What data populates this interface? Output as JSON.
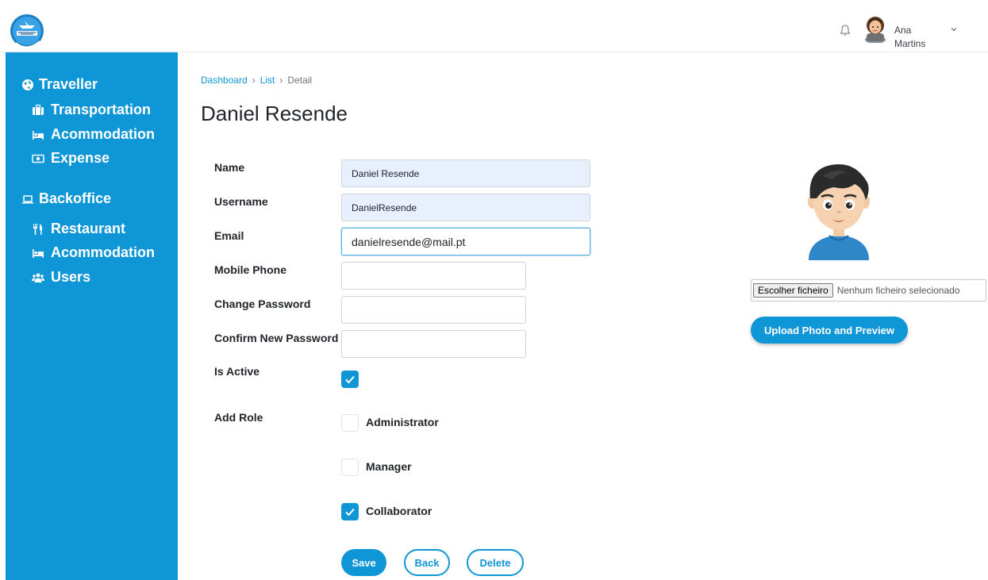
{
  "header": {
    "logo_icon": "airplane-globe-logo",
    "notification_icon": "bell-icon",
    "user": {
      "first_name": "Ana",
      "last_name": "Martins",
      "menu_icon": "chevron-down-icon"
    }
  },
  "sidebar": {
    "sections": [
      {
        "label": "Traveller",
        "icon": "globe-icon",
        "items": [
          {
            "label": "Transportation",
            "icon": "suitcase-icon"
          },
          {
            "label": "Acommodation",
            "icon": "bed-icon"
          },
          {
            "label": "Expense",
            "icon": "money-bill-icon"
          }
        ]
      },
      {
        "label": "Backoffice",
        "icon": "laptop-icon",
        "items": [
          {
            "label": "Restaurant",
            "icon": "utensils-icon"
          },
          {
            "label": "Acommodation",
            "icon": "bed-icon"
          },
          {
            "label": "Users",
            "icon": "users-icon"
          }
        ]
      }
    ]
  },
  "breadcrumb": {
    "items": [
      "Dashboard",
      "List",
      "Detail"
    ],
    "separator": "›"
  },
  "page": {
    "title": "Daniel Resende"
  },
  "form": {
    "name": {
      "label": "Name",
      "value": "Daniel Resende"
    },
    "username": {
      "label": "Username",
      "value": "DanielResende"
    },
    "email": {
      "label": "Email",
      "value": "danielresende@mail.pt"
    },
    "mobile_phone": {
      "label": "Mobile Phone",
      "value": ""
    },
    "change_password": {
      "label": "Change Password",
      "value": ""
    },
    "confirm_password": {
      "label": "Confirm New Password",
      "value": ""
    },
    "is_active": {
      "label": "Is Active",
      "checked": true
    },
    "roles": {
      "label": "Add Role",
      "options": [
        {
          "label": "Administrator",
          "checked": false
        },
        {
          "label": "Manager",
          "checked": false
        },
        {
          "label": "Collaborator",
          "checked": true
        }
      ]
    }
  },
  "actions": {
    "save": "Save",
    "back": "Back",
    "delete": "Delete"
  },
  "photo": {
    "file_button": "Escolher ficheiro",
    "file_status": "Nenhum ficheiro selecionado",
    "upload_button": "Upload Photo and Preview",
    "avatar_icon": "boy-avatar-icon"
  },
  "colors": {
    "primary": "#0f96d6",
    "readonly_bg": "#e8f0fe"
  }
}
